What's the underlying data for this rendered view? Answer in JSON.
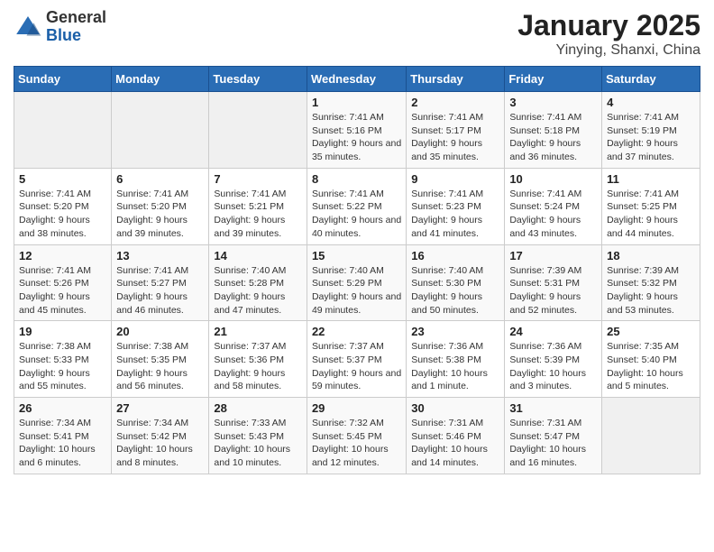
{
  "header": {
    "logo_general": "General",
    "logo_blue": "Blue",
    "month_title": "January 2025",
    "location": "Yinying, Shanxi, China"
  },
  "days_of_week": [
    "Sunday",
    "Monday",
    "Tuesday",
    "Wednesday",
    "Thursday",
    "Friday",
    "Saturday"
  ],
  "weeks": [
    [
      {
        "day": "",
        "info": ""
      },
      {
        "day": "",
        "info": ""
      },
      {
        "day": "",
        "info": ""
      },
      {
        "day": "1",
        "info": "Sunrise: 7:41 AM\nSunset: 5:16 PM\nDaylight: 9 hours and 35 minutes."
      },
      {
        "day": "2",
        "info": "Sunrise: 7:41 AM\nSunset: 5:17 PM\nDaylight: 9 hours and 35 minutes."
      },
      {
        "day": "3",
        "info": "Sunrise: 7:41 AM\nSunset: 5:18 PM\nDaylight: 9 hours and 36 minutes."
      },
      {
        "day": "4",
        "info": "Sunrise: 7:41 AM\nSunset: 5:19 PM\nDaylight: 9 hours and 37 minutes."
      }
    ],
    [
      {
        "day": "5",
        "info": "Sunrise: 7:41 AM\nSunset: 5:20 PM\nDaylight: 9 hours and 38 minutes."
      },
      {
        "day": "6",
        "info": "Sunrise: 7:41 AM\nSunset: 5:20 PM\nDaylight: 9 hours and 39 minutes."
      },
      {
        "day": "7",
        "info": "Sunrise: 7:41 AM\nSunset: 5:21 PM\nDaylight: 9 hours and 39 minutes."
      },
      {
        "day": "8",
        "info": "Sunrise: 7:41 AM\nSunset: 5:22 PM\nDaylight: 9 hours and 40 minutes."
      },
      {
        "day": "9",
        "info": "Sunrise: 7:41 AM\nSunset: 5:23 PM\nDaylight: 9 hours and 41 minutes."
      },
      {
        "day": "10",
        "info": "Sunrise: 7:41 AM\nSunset: 5:24 PM\nDaylight: 9 hours and 43 minutes."
      },
      {
        "day": "11",
        "info": "Sunrise: 7:41 AM\nSunset: 5:25 PM\nDaylight: 9 hours and 44 minutes."
      }
    ],
    [
      {
        "day": "12",
        "info": "Sunrise: 7:41 AM\nSunset: 5:26 PM\nDaylight: 9 hours and 45 minutes."
      },
      {
        "day": "13",
        "info": "Sunrise: 7:41 AM\nSunset: 5:27 PM\nDaylight: 9 hours and 46 minutes."
      },
      {
        "day": "14",
        "info": "Sunrise: 7:40 AM\nSunset: 5:28 PM\nDaylight: 9 hours and 47 minutes."
      },
      {
        "day": "15",
        "info": "Sunrise: 7:40 AM\nSunset: 5:29 PM\nDaylight: 9 hours and 49 minutes."
      },
      {
        "day": "16",
        "info": "Sunrise: 7:40 AM\nSunset: 5:30 PM\nDaylight: 9 hours and 50 minutes."
      },
      {
        "day": "17",
        "info": "Sunrise: 7:39 AM\nSunset: 5:31 PM\nDaylight: 9 hours and 52 minutes."
      },
      {
        "day": "18",
        "info": "Sunrise: 7:39 AM\nSunset: 5:32 PM\nDaylight: 9 hours and 53 minutes."
      }
    ],
    [
      {
        "day": "19",
        "info": "Sunrise: 7:38 AM\nSunset: 5:33 PM\nDaylight: 9 hours and 55 minutes."
      },
      {
        "day": "20",
        "info": "Sunrise: 7:38 AM\nSunset: 5:35 PM\nDaylight: 9 hours and 56 minutes."
      },
      {
        "day": "21",
        "info": "Sunrise: 7:37 AM\nSunset: 5:36 PM\nDaylight: 9 hours and 58 minutes."
      },
      {
        "day": "22",
        "info": "Sunrise: 7:37 AM\nSunset: 5:37 PM\nDaylight: 9 hours and 59 minutes."
      },
      {
        "day": "23",
        "info": "Sunrise: 7:36 AM\nSunset: 5:38 PM\nDaylight: 10 hours and 1 minute."
      },
      {
        "day": "24",
        "info": "Sunrise: 7:36 AM\nSunset: 5:39 PM\nDaylight: 10 hours and 3 minutes."
      },
      {
        "day": "25",
        "info": "Sunrise: 7:35 AM\nSunset: 5:40 PM\nDaylight: 10 hours and 5 minutes."
      }
    ],
    [
      {
        "day": "26",
        "info": "Sunrise: 7:34 AM\nSunset: 5:41 PM\nDaylight: 10 hours and 6 minutes."
      },
      {
        "day": "27",
        "info": "Sunrise: 7:34 AM\nSunset: 5:42 PM\nDaylight: 10 hours and 8 minutes."
      },
      {
        "day": "28",
        "info": "Sunrise: 7:33 AM\nSunset: 5:43 PM\nDaylight: 10 hours and 10 minutes."
      },
      {
        "day": "29",
        "info": "Sunrise: 7:32 AM\nSunset: 5:45 PM\nDaylight: 10 hours and 12 minutes."
      },
      {
        "day": "30",
        "info": "Sunrise: 7:31 AM\nSunset: 5:46 PM\nDaylight: 10 hours and 14 minutes."
      },
      {
        "day": "31",
        "info": "Sunrise: 7:31 AM\nSunset: 5:47 PM\nDaylight: 10 hours and 16 minutes."
      },
      {
        "day": "",
        "info": ""
      }
    ]
  ]
}
